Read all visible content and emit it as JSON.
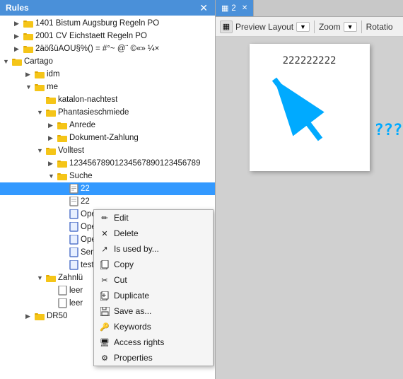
{
  "left_panel": {
    "header": {
      "title": "Rules",
      "close_btn": "✕"
    },
    "tree": [
      {
        "id": "item1",
        "label": "1401 Bistum Augsburg Regeln PO",
        "indent": "indent2",
        "arrow": "right",
        "icon": "folder",
        "selected": false
      },
      {
        "id": "item2",
        "label": "2001 CV Eichstaett Regeln PO",
        "indent": "indent2",
        "arrow": "right",
        "icon": "folder",
        "selected": false
      },
      {
        "id": "item3",
        "label": "2äößüÄÖÜ§%() = #°~ @¨ ©«» ¼×",
        "indent": "indent2",
        "arrow": "right",
        "icon": "folder",
        "selected": false
      },
      {
        "id": "cartago",
        "label": "Cartago",
        "indent": "indent1",
        "arrow": "down",
        "icon": "folder",
        "selected": false
      },
      {
        "id": "idm",
        "label": "idm",
        "indent": "indent3",
        "arrow": "right",
        "icon": "folder",
        "selected": false
      },
      {
        "id": "me",
        "label": "me",
        "indent": "indent3",
        "arrow": "down",
        "icon": "folder",
        "selected": false
      },
      {
        "id": "katalon",
        "label": "katalon-nachtest",
        "indent": "indent4",
        "arrow": "empty",
        "icon": "folder",
        "selected": false
      },
      {
        "id": "phantasie",
        "label": "Phantasieschmiede",
        "indent": "indent4",
        "arrow": "down",
        "icon": "folder",
        "selected": false
      },
      {
        "id": "anrede",
        "label": "Anrede",
        "indent": "indent5",
        "arrow": "right",
        "icon": "folder",
        "selected": false
      },
      {
        "id": "dokument",
        "label": "Dokument-Zahlung",
        "indent": "indent5",
        "arrow": "right",
        "icon": "folder",
        "selected": false
      },
      {
        "id": "volltest",
        "label": "Volltest",
        "indent": "indent4",
        "arrow": "down",
        "icon": "folder",
        "selected": false
      },
      {
        "id": "longname",
        "label": "12345678901234567890123456789",
        "indent": "indent5",
        "arrow": "right",
        "icon": "folder",
        "selected": false
      },
      {
        "id": "suche",
        "label": "Suche",
        "indent": "indent5",
        "arrow": "down",
        "icon": "folder",
        "selected": false
      },
      {
        "id": "item22a",
        "label": "22",
        "indent": "indent6",
        "arrow": "empty",
        "icon": "file",
        "selected": true
      },
      {
        "id": "item22b",
        "label": "22",
        "indent": "indent6",
        "arrow": "empty",
        "icon": "file",
        "selected": false
      },
      {
        "id": "itemOpe1",
        "label": "Ope",
        "indent": "indent6",
        "arrow": "empty",
        "icon": "filespec",
        "selected": false
      },
      {
        "id": "itemOpe2",
        "label": "Ope",
        "indent": "indent6",
        "arrow": "empty",
        "icon": "filespec",
        "selected": false
      },
      {
        "id": "itemOpe3",
        "label": "Ope",
        "indent": "indent6",
        "arrow": "empty",
        "icon": "filespec",
        "selected": false
      },
      {
        "id": "itemSen",
        "label": "Sen",
        "indent": "indent6",
        "arrow": "empty",
        "icon": "filespec",
        "selected": false
      },
      {
        "id": "itemtest",
        "label": "test",
        "indent": "indent6",
        "arrow": "empty",
        "icon": "filespec",
        "selected": false
      },
      {
        "id": "zahnlu",
        "label": "Zahnlü",
        "indent": "indent4",
        "arrow": "down",
        "icon": "folder",
        "selected": false
      },
      {
        "id": "leer1",
        "label": "leer",
        "indent": "indent5",
        "arrow": "empty",
        "icon": "file",
        "selected": false
      },
      {
        "id": "leer2",
        "label": "leer",
        "indent": "indent5",
        "arrow": "empty",
        "icon": "file",
        "selected": false
      },
      {
        "id": "drp50",
        "label": "DR50",
        "indent": "indent3",
        "arrow": "right",
        "icon": "folder",
        "selected": false
      }
    ]
  },
  "context_menu": {
    "items": [
      {
        "id": "edit",
        "label": "Edit",
        "icon": "pencil",
        "shortcut": ""
      },
      {
        "id": "delete",
        "label": "Delete",
        "icon": "x",
        "shortcut": ""
      },
      {
        "id": "isusedby",
        "label": "Is used by...",
        "icon": "share",
        "shortcut": ""
      },
      {
        "id": "copy",
        "label": "Copy",
        "icon": "copy",
        "shortcut": ""
      },
      {
        "id": "cut",
        "label": "Cut",
        "icon": "scissors",
        "shortcut": ""
      },
      {
        "id": "duplicate",
        "label": "Duplicate",
        "icon": "duplicate",
        "shortcut": ""
      },
      {
        "id": "saveas",
        "label": "Save as...",
        "icon": "save",
        "shortcut": ""
      },
      {
        "id": "keywords",
        "label": "Keywords",
        "icon": "key",
        "shortcut": ""
      },
      {
        "id": "accessrights",
        "label": "Access rights",
        "icon": "display",
        "shortcut": ""
      },
      {
        "id": "properties",
        "label": "Properties",
        "icon": "gear",
        "shortcut": ""
      }
    ]
  },
  "right_panel": {
    "tab": {
      "icon": "grid",
      "number": "2",
      "close_btn": "✕"
    },
    "toolbar": {
      "layout_icon": "▦",
      "layout_label": "Preview Layout",
      "dropdown_arrow": "▼",
      "zoom_label": "Zoom",
      "zoom_arrow": "▼",
      "rotation_label": "Rotatio"
    },
    "preview": {
      "text": "222222222",
      "question_marks": "????"
    }
  }
}
